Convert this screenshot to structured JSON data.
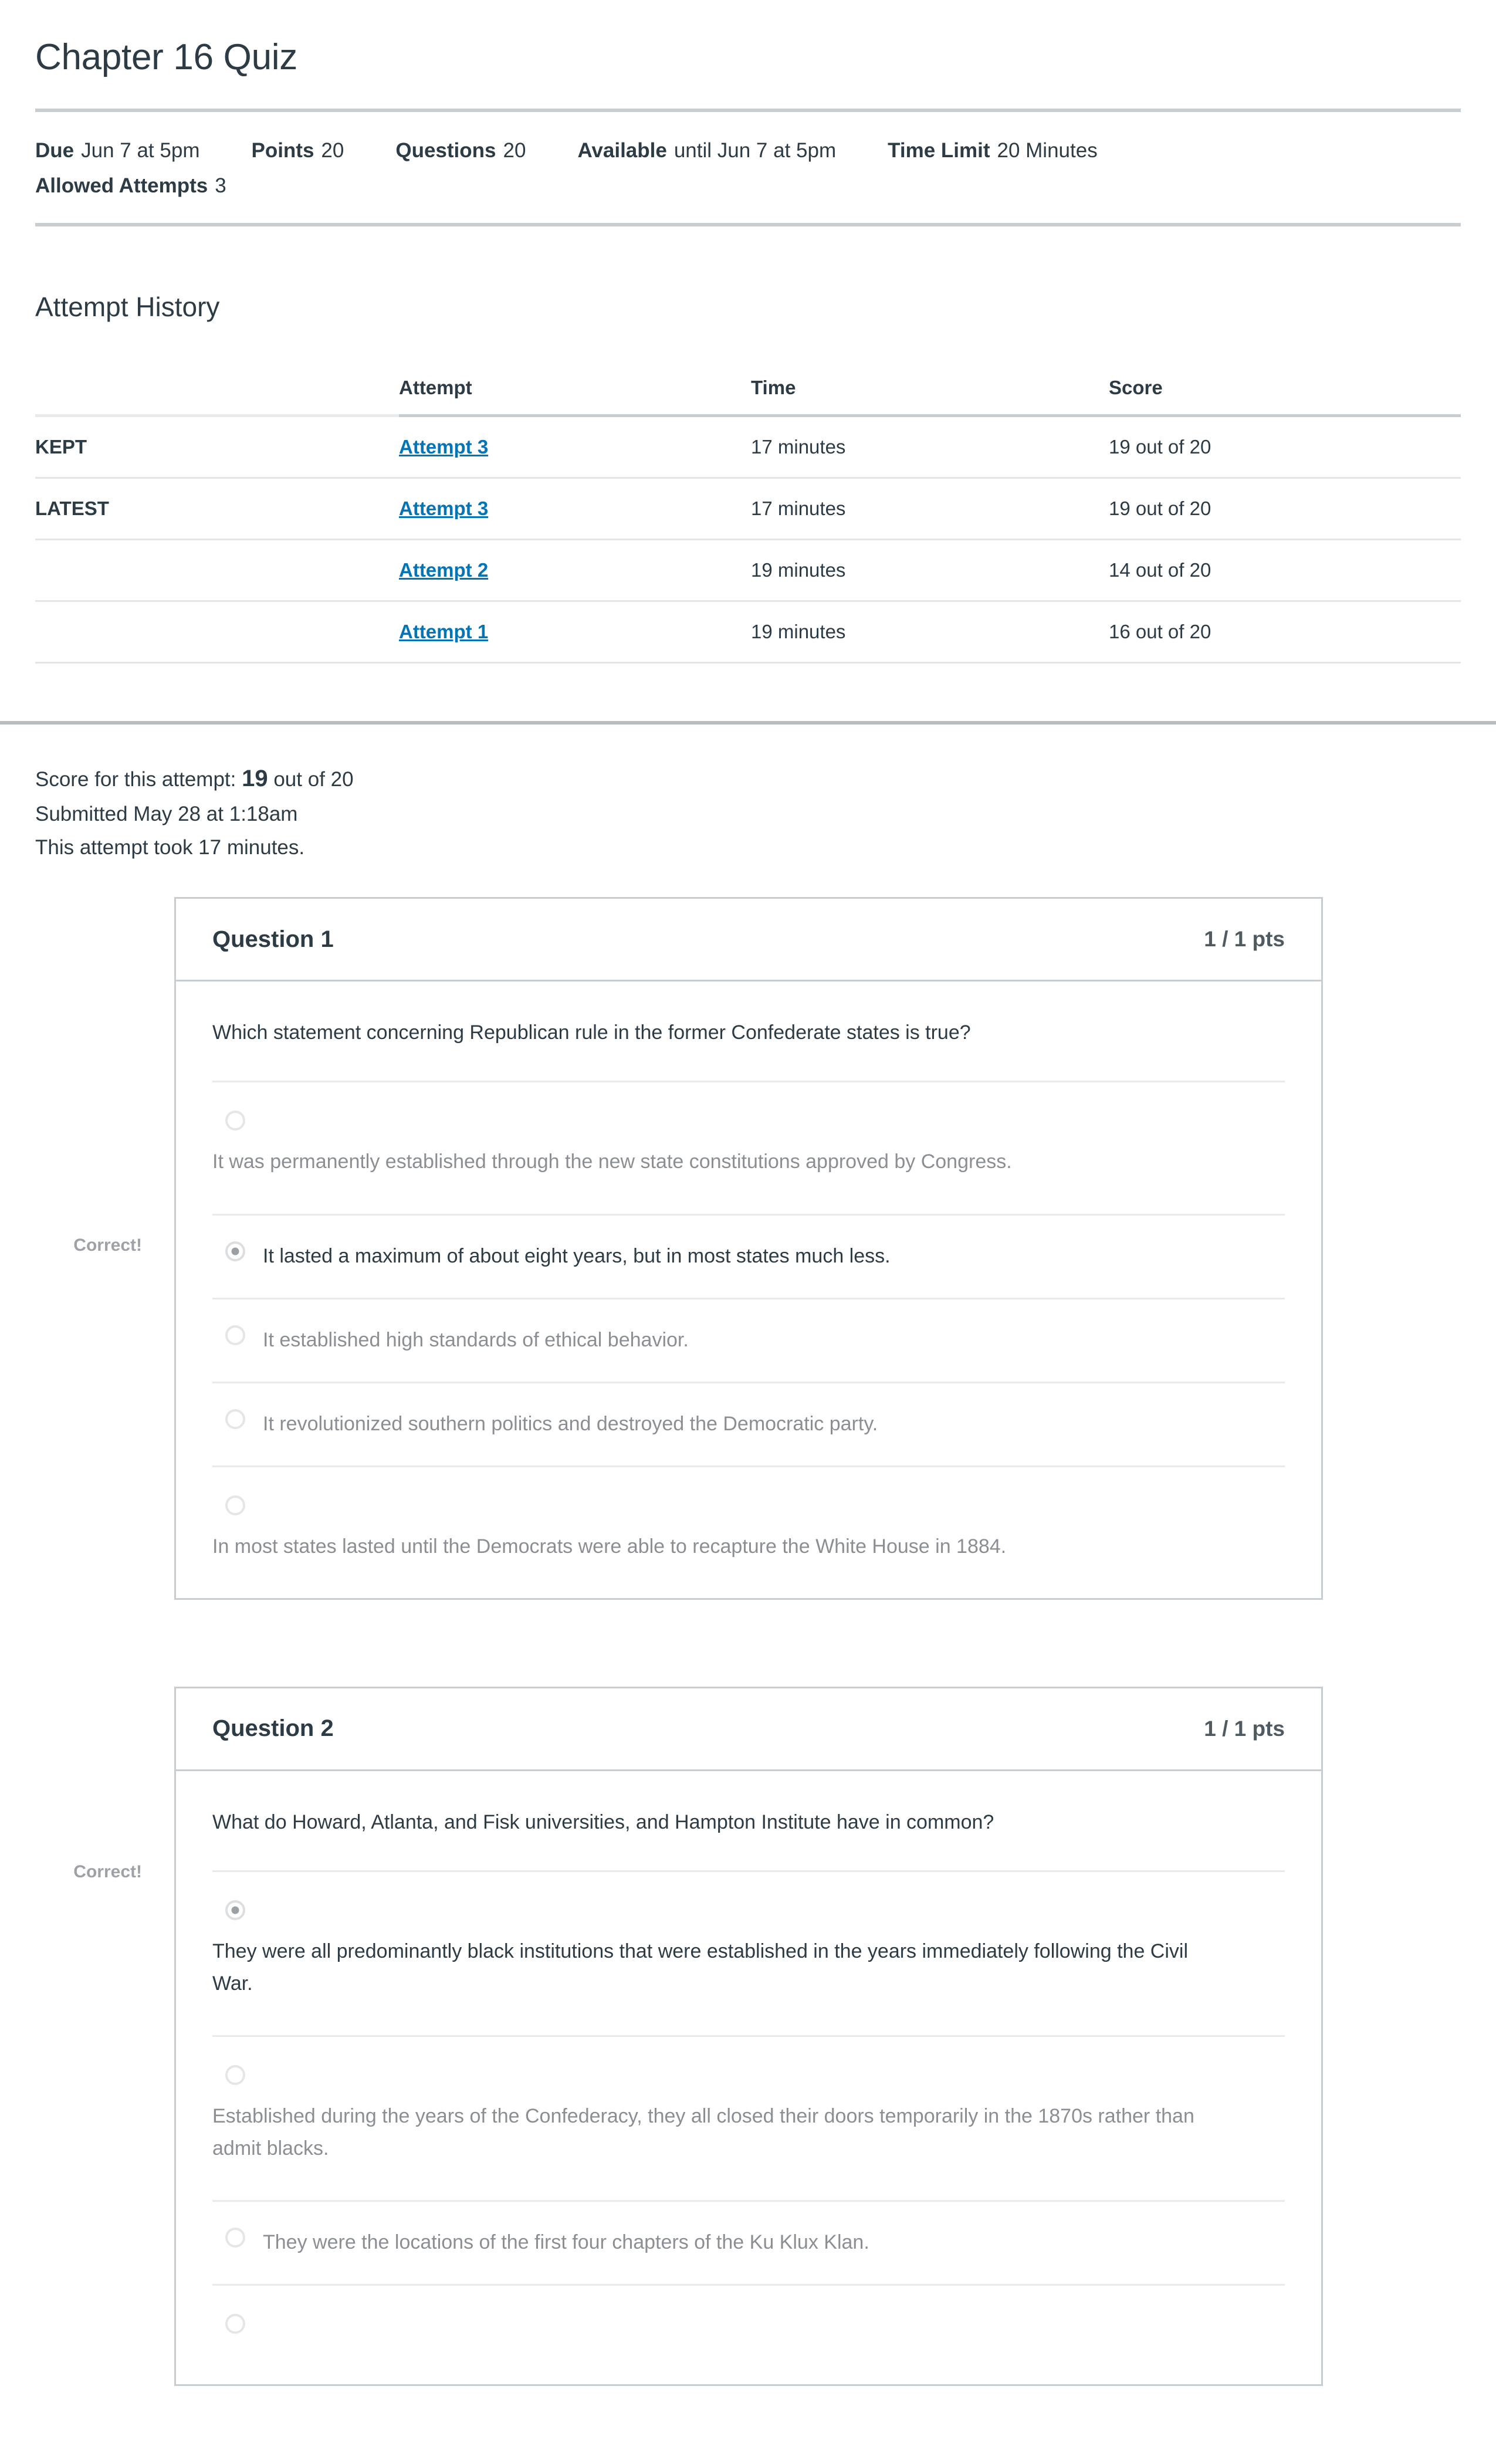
{
  "quiz": {
    "title": "Chapter 16 Quiz",
    "meta": [
      {
        "label": "Due",
        "value": "Jun 7 at 5pm"
      },
      {
        "label": "Points",
        "value": "20"
      },
      {
        "label": "Questions",
        "value": "20"
      },
      {
        "label": "Available",
        "value": "until Jun 7 at 5pm"
      },
      {
        "label": "Time Limit",
        "value": "20 Minutes"
      }
    ],
    "meta2": [
      {
        "label": "Allowed Attempts",
        "value": "3"
      }
    ]
  },
  "attempt_history": {
    "heading": "Attempt History",
    "columns": [
      "",
      "Attempt",
      "Time",
      "Score"
    ],
    "rows": [
      {
        "tag": "KEPT",
        "attempt": "Attempt 3 ",
        "time": "17 minutes",
        "score": "19 out of 20"
      },
      {
        "tag": "LATEST",
        "attempt": "Attempt 3 ",
        "time": "17 minutes",
        "score": "19 out of 20"
      },
      {
        "tag": "",
        "attempt": "Attempt 2 ",
        "time": "19 minutes",
        "score": "14 out of 20"
      },
      {
        "tag": "",
        "attempt": "Attempt 1 ",
        "time": "19 minutes",
        "score": "16 out of 20"
      }
    ]
  },
  "summary": {
    "score_prefix": "Score for this attempt:",
    "score_value": "19",
    "score_suffix": "out of 20",
    "submitted": "Submitted May 28 at 1:18am",
    "duration": "This attempt took 17 minutes."
  },
  "questions": [
    {
      "name": "Question 1",
      "points": "1 / 1 pts",
      "text": "Which statement concerning Republican rule in the former Confederate states is true?",
      "marker": "Correct!",
      "answers": [
        {
          "text": "It was permanently established through the new state constitutions approved by Congress.",
          "selected": false,
          "layout": "block"
        },
        {
          "text": "It lasted a maximum of about eight years, but in most states much less.",
          "selected": true,
          "layout": "inline"
        },
        {
          "text": "It established high standards of ethical behavior.",
          "selected": false,
          "layout": "inline"
        },
        {
          "text": "It revolutionized southern politics and destroyed the Democratic party.",
          "selected": false,
          "layout": "inline"
        },
        {
          "text": "In most states lasted until the Democrats were able to recapture the White House in 1884.",
          "selected": false,
          "layout": "block"
        }
      ]
    },
    {
      "name": "Question 2",
      "points": "1 / 1 pts",
      "text": "What do Howard, Atlanta, and Fisk universities, and Hampton Institute have in common?",
      "marker": "Correct!",
      "answers": [
        {
          "text": "They were all predominantly black institutions that were established in the years immediately following the Civil War.",
          "selected": true,
          "layout": "block"
        },
        {
          "text": "Established during the years of the Confederacy, they all closed their doors temporarily in the 1870s rather than admit blacks.",
          "selected": false,
          "layout": "block"
        },
        {
          "text": "They were the locations of the first four chapters of the Ku Klux Klan.",
          "selected": false,
          "layout": "inline"
        },
        {
          "text": "",
          "selected": false,
          "layout": "block"
        }
      ]
    }
  ],
  "colors": {
    "link": "#0374b5",
    "text": "#2d3b45",
    "muted": "#8b8f93",
    "rule": "#c7cdd1"
  }
}
